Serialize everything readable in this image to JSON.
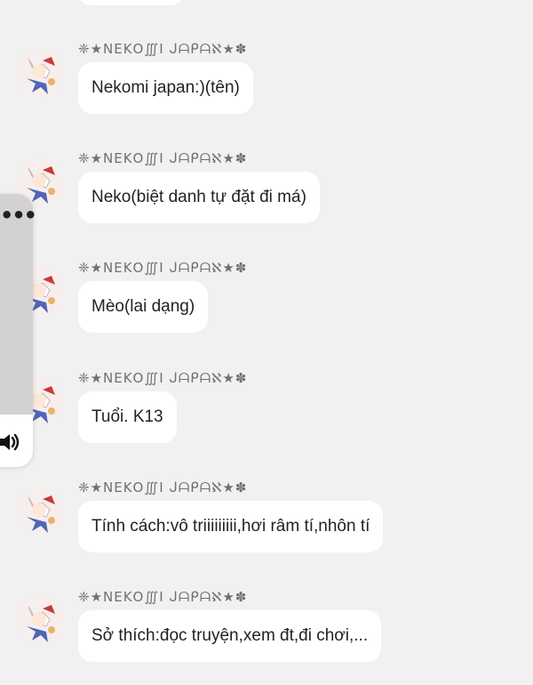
{
  "sender_name": "❈★ΝΕΚΟ∭Ι ᒍᗩᑭᗩℵ★✽",
  "messages": [
    {
      "text": "Nekomi japan:)(tên)"
    },
    {
      "text": "Neko(biệt danh tự đặt đi má)"
    },
    {
      "text": "Mèo(lai dạng)"
    },
    {
      "text": "Tuổi. K13"
    },
    {
      "text": "Tính cách:vô triiiiiiiii,hơi râm tí,nhôn tí"
    },
    {
      "text": "Sở thích:đọc truyện,xem đt,đi chơi,..."
    }
  ],
  "side_panel": {
    "more_icon": "more-dots-icon",
    "sound_icon": "speaker-icon"
  },
  "colors": {
    "background": "#f1f1f1",
    "bubble": "#ffffff",
    "text": "#222222",
    "sender": "#707070"
  }
}
